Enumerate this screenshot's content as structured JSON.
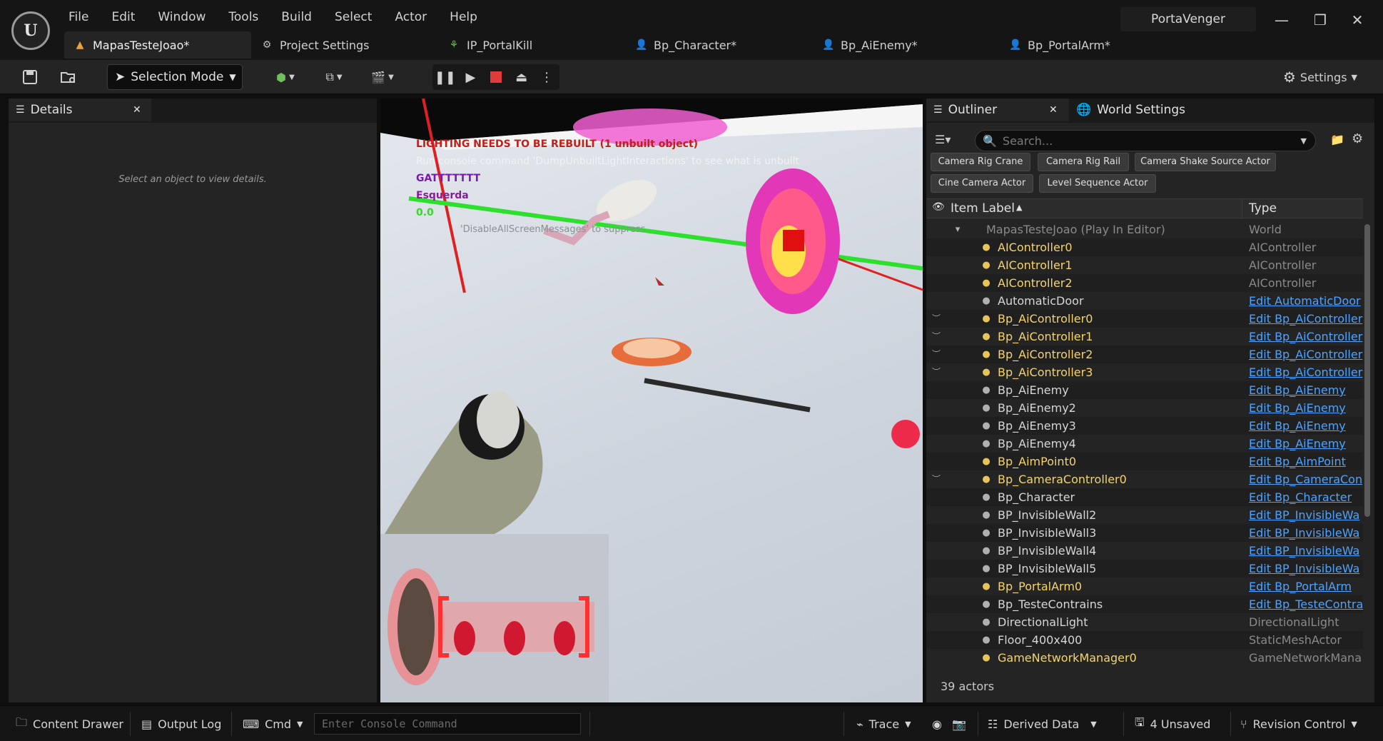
{
  "menu": [
    "File",
    "Edit",
    "Window",
    "Tools",
    "Build",
    "Select",
    "Actor",
    "Help"
  ],
  "project_name": "PortaVenger",
  "window_controls": {
    "minimize": "—",
    "restore": "❐",
    "close": "✕"
  },
  "tabs": [
    {
      "label": "MapasTesteJoao*",
      "icon": "level-icon",
      "glyph": "▲"
    },
    {
      "label": "Project Settings",
      "icon": "settings-icon",
      "glyph": "⚙"
    },
    {
      "label": "IP_PortalKill",
      "icon": "blueprint-icon",
      "glyph": "⚘"
    },
    {
      "label": "Bp_Character*",
      "icon": "character-icon",
      "glyph": "👤"
    },
    {
      "label": "Bp_AiEnemy*",
      "icon": "character-icon",
      "glyph": "👤"
    },
    {
      "label": "Bp_PortalArm*",
      "icon": "pawn-icon",
      "glyph": "👤"
    }
  ],
  "toolbar": {
    "selection_mode": "Selection Mode",
    "settings": "Settings"
  },
  "details": {
    "tab_label": "Details",
    "empty_text": "Select an object to view details."
  },
  "viewport": {
    "messages": [
      {
        "text": "LIGHTING NEEDS TO BE REBUILT (1 unbuilt object)",
        "color": "#c0201a"
      },
      {
        "text": "Run console command 'DumpUnbuiltLightInteractions' to see what is unbuilt",
        "color": "#f2f2f2"
      },
      {
        "text": "GATTTTTTT",
        "color": "#7a1ab0"
      },
      {
        "text": "Esquerda",
        "color": "#8a1a9a"
      },
      {
        "text": "0.0",
        "color": "#3ad62a"
      }
    ],
    "suppress_text": "'DisableAllScreenMessages' to suppress"
  },
  "outliner": {
    "tab_label": "Outliner",
    "world_settings_label": "World Settings",
    "search_placeholder": "Search...",
    "filters": [
      "Camera Rig Crane",
      "Camera Rig Rail",
      "Camera Shake Source Actor",
      "Cine Camera Actor",
      "Level Sequence Actor"
    ],
    "col_label": "Item Label",
    "col_type": "Type",
    "rows": [
      {
        "label": "MapasTesteJoao (Play In Editor)",
        "type": "World",
        "style": "world",
        "link": false,
        "eye": false
      },
      {
        "label": "AIController0",
        "type": "AIController",
        "style": "yellow",
        "link": false,
        "eye": false
      },
      {
        "label": "AIController1",
        "type": "AIController",
        "style": "yellow",
        "link": false,
        "eye": false
      },
      {
        "label": "AIController2",
        "type": "AIController",
        "style": "yellow",
        "link": false,
        "eye": false
      },
      {
        "label": "AutomaticDoor",
        "type": "Edit AutomaticDoor",
        "style": "white",
        "link": true,
        "eye": false
      },
      {
        "label": "Bp_AiController0",
        "type": "Edit Bp_AiController",
        "style": "yellow",
        "link": true,
        "eye": true
      },
      {
        "label": "Bp_AiController1",
        "type": "Edit Bp_AiController",
        "style": "yellow",
        "link": true,
        "eye": true
      },
      {
        "label": "Bp_AiController2",
        "type": "Edit Bp_AiController",
        "style": "yellow",
        "link": true,
        "eye": true
      },
      {
        "label": "Bp_AiController3",
        "type": "Edit Bp_AiController",
        "style": "yellow",
        "link": true,
        "eye": true
      },
      {
        "label": "Bp_AiEnemy",
        "type": "Edit Bp_AiEnemy",
        "style": "white",
        "link": true,
        "eye": false
      },
      {
        "label": "Bp_AiEnemy2",
        "type": "Edit Bp_AiEnemy",
        "style": "white",
        "link": true,
        "eye": false
      },
      {
        "label": "Bp_AiEnemy3",
        "type": "Edit Bp_AiEnemy",
        "style": "white",
        "link": true,
        "eye": false
      },
      {
        "label": "Bp_AiEnemy4",
        "type": "Edit Bp_AiEnemy",
        "style": "white",
        "link": true,
        "eye": false
      },
      {
        "label": "Bp_AimPoint0",
        "type": "Edit Bp_AimPoint",
        "style": "yellow",
        "link": true,
        "eye": false
      },
      {
        "label": "Bp_CameraController0",
        "type": "Edit Bp_CameraCon",
        "style": "yellow",
        "link": true,
        "eye": true
      },
      {
        "label": "Bp_Character",
        "type": "Edit Bp_Character",
        "style": "white",
        "link": true,
        "eye": false
      },
      {
        "label": "BP_InvisibleWall2",
        "type": "Edit BP_InvisibleWa",
        "style": "white",
        "link": true,
        "eye": false
      },
      {
        "label": "BP_InvisibleWall3",
        "type": "Edit BP_InvisibleWa",
        "style": "white",
        "link": true,
        "eye": false
      },
      {
        "label": "BP_InvisibleWall4",
        "type": "Edit BP_InvisibleWa",
        "style": "white",
        "link": true,
        "eye": false
      },
      {
        "label": "BP_InvisibleWall5",
        "type": "Edit BP_InvisibleWa",
        "style": "white",
        "link": true,
        "eye": false
      },
      {
        "label": "Bp_PortalArm0",
        "type": "Edit Bp_PortalArm",
        "style": "yellow",
        "link": true,
        "eye": false
      },
      {
        "label": "Bp_TesteContrains",
        "type": "Edit Bp_TesteContra",
        "style": "white",
        "link": true,
        "eye": false
      },
      {
        "label": "DirectionalLight",
        "type": "DirectionalLight",
        "style": "white",
        "link": false,
        "eye": false
      },
      {
        "label": "Floor_400x400",
        "type": "StaticMeshActor",
        "style": "white",
        "link": false,
        "eye": false
      },
      {
        "label": "GameNetworkManager0",
        "type": "GameNetworkMana",
        "style": "yellow",
        "link": false,
        "eye": false
      }
    ],
    "actor_count": "39 actors"
  },
  "statusbar": {
    "content_drawer": "Content Drawer",
    "output_log": "Output Log",
    "cmd": "Cmd",
    "console_placeholder": "Enter Console Command",
    "trace": "Trace",
    "derived_data": "Derived Data",
    "unsaved": "4 Unsaved",
    "revision_control": "Revision Control"
  },
  "colors": {
    "accent": "#f4d46a",
    "link": "#4ea3ff",
    "panel": "#242424",
    "background": "#0f0f0f"
  }
}
